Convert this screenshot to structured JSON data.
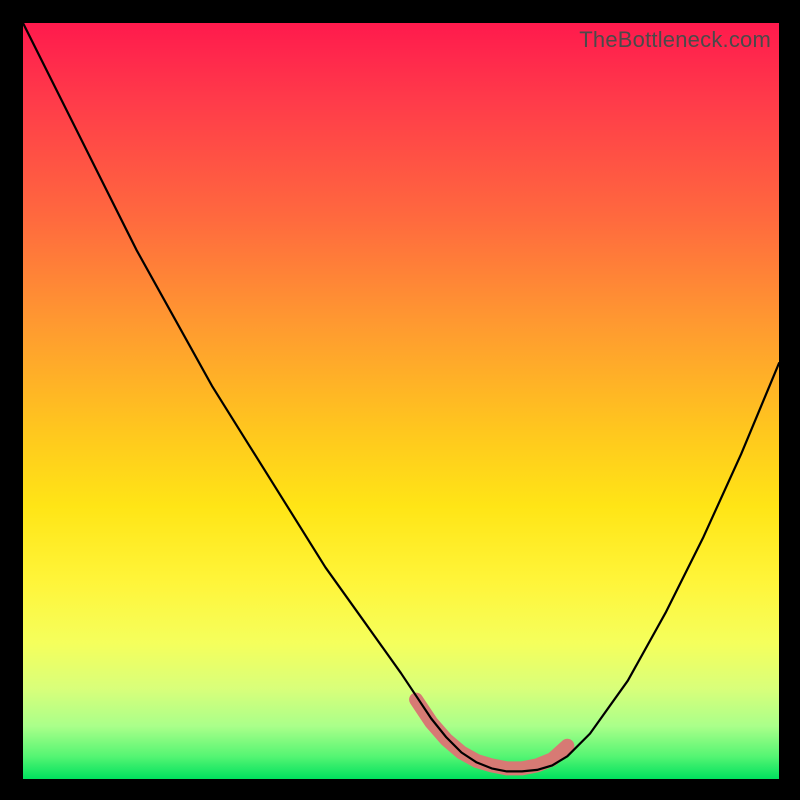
{
  "watermark": "TheBottleneck.com",
  "chart_data": {
    "type": "line",
    "title": "",
    "xlabel": "",
    "ylabel": "",
    "xlim": [
      0,
      100
    ],
    "ylim": [
      0,
      100
    ],
    "series": [
      {
        "name": "main-curve",
        "x": [
          0,
          5,
          10,
          15,
          20,
          25,
          30,
          35,
          40,
          45,
          50,
          52,
          54,
          56,
          58,
          60,
          62,
          64,
          66,
          68,
          70,
          72,
          75,
          80,
          85,
          90,
          95,
          100
        ],
        "y": [
          100,
          90,
          80,
          70,
          61,
          52,
          44,
          36,
          28,
          21,
          14,
          11,
          8,
          5.5,
          3.5,
          2.2,
          1.4,
          1.0,
          1.0,
          1.2,
          1.8,
          3.0,
          6.0,
          13,
          22,
          32,
          43,
          55
        ]
      },
      {
        "name": "trough-highlight",
        "x": [
          52,
          54,
          56,
          58,
          60,
          62,
          64,
          66,
          68,
          70,
          72
        ],
        "y": [
          10.5,
          7.5,
          5.2,
          3.5,
          2.4,
          1.8,
          1.4,
          1.4,
          1.8,
          2.6,
          4.4
        ]
      }
    ],
    "colors": {
      "main_curve": "#000000",
      "trough_highlight": "#d77a74",
      "gradient_top": "#ff1a4d",
      "gradient_mid": "#ffe516",
      "gradient_bottom": "#00e05e"
    }
  }
}
